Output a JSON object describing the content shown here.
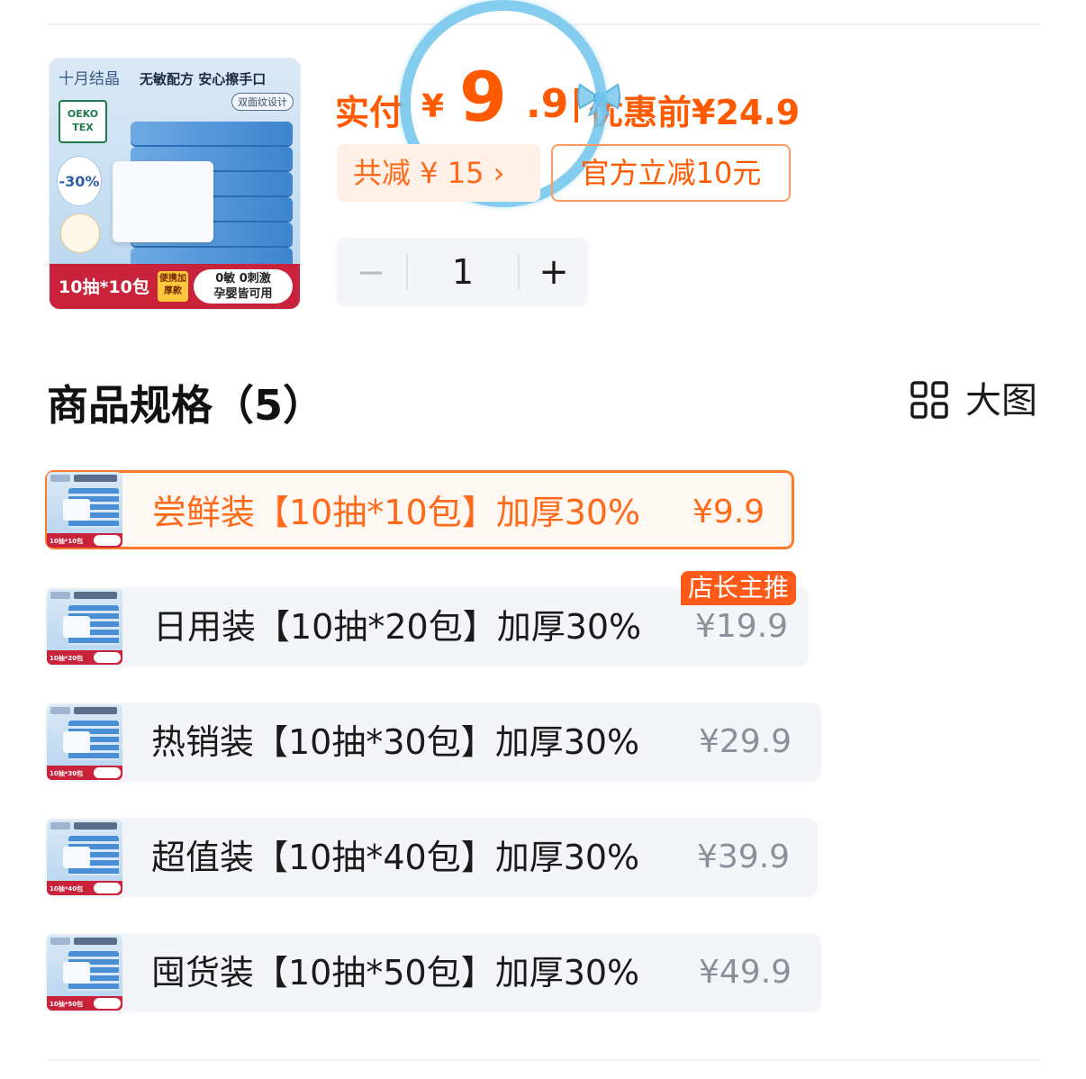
{
  "product": {
    "image": {
      "brand": "十月结晶",
      "slogan": "无敏配方 安心擦手口",
      "pill": "双面纹设计",
      "oeko_line1": "OEKO",
      "oeko_line2": "TEX",
      "percent": "-30%",
      "band_text": "10抽*10包",
      "band_tag": "便携加厚款",
      "band_pill_line1": "0敏 0刺激",
      "band_pill_line2": "孕婴皆可用"
    },
    "pay_label": "实付",
    "pay_currency": "¥",
    "pay_integer": "9",
    "pay_decimal": ".9",
    "before_label": "优惠前¥24.9",
    "total_save": "共减 ¥ 15 ›",
    "official_discount": "官方立减10元"
  },
  "stepper": {
    "minus": "−",
    "quantity": "1",
    "plus": "+"
  },
  "spec": {
    "title": "商品规格（5）",
    "big_view_label": "大图",
    "hot_badge": "店长主推",
    "items": [
      {
        "name": "尝鲜装【10抽*10包】加厚30%",
        "price": "¥9.9",
        "band": "10抽*10包",
        "selected": true
      },
      {
        "name": "日用装【10抽*20包】加厚30%",
        "price": "¥19.9",
        "band": "10抽*20包",
        "selected": false
      },
      {
        "name": "热销装【10抽*30包】加厚30%",
        "price": "¥29.9",
        "band": "10抽*30包",
        "selected": false
      },
      {
        "name": "超值装【10抽*40包】加厚30%",
        "price": "¥39.9",
        "band": "10抽*40包",
        "selected": false
      },
      {
        "name": "囤货装【10抽*50包】加厚30%",
        "price": "¥49.9",
        "band": "10抽*50包",
        "selected": false
      }
    ]
  },
  "colors": {
    "accent": "#ff5a00",
    "selected_border": "#ff7a2b",
    "item_bg": "#f3f5f8",
    "overlay_circle": "#6ec4ec"
  }
}
